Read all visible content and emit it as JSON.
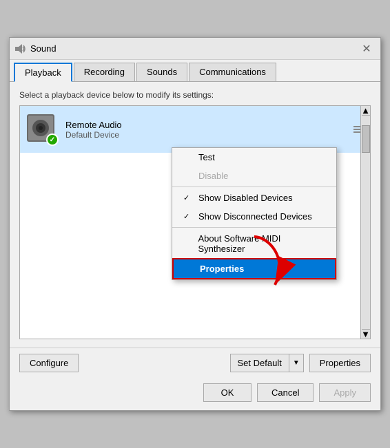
{
  "window": {
    "title": "Sound",
    "close_label": "✕"
  },
  "tabs": [
    {
      "label": "Playback",
      "active": true
    },
    {
      "label": "Recording",
      "active": false
    },
    {
      "label": "Sounds",
      "active": false
    },
    {
      "label": "Communications",
      "active": false
    }
  ],
  "description": "Select a playback device below to modify its settings:",
  "device": {
    "name": "Remote Audio",
    "status": "Default Device"
  },
  "context_menu": {
    "items": [
      {
        "id": "test",
        "label": "Test",
        "check": "",
        "disabled": false
      },
      {
        "id": "disable",
        "label": "Disable",
        "check": "",
        "disabled": true
      },
      {
        "id": "sep1",
        "type": "separator"
      },
      {
        "id": "show-disabled",
        "label": "Show Disabled Devices",
        "check": "✓",
        "disabled": false
      },
      {
        "id": "show-disconnected",
        "label": "Show Disconnected Devices",
        "check": "✓",
        "disabled": false
      },
      {
        "id": "sep2",
        "type": "separator"
      },
      {
        "id": "about",
        "label": "About Software MIDI Synthesizer",
        "check": "",
        "disabled": false
      },
      {
        "id": "properties",
        "label": "Properties",
        "check": "",
        "disabled": false,
        "bold": true
      }
    ]
  },
  "bottom_bar": {
    "configure_label": "Configure",
    "set_default_label": "Set Default",
    "properties_label": "Properties"
  },
  "footer": {
    "ok_label": "OK",
    "cancel_label": "Cancel",
    "apply_label": "Apply"
  }
}
